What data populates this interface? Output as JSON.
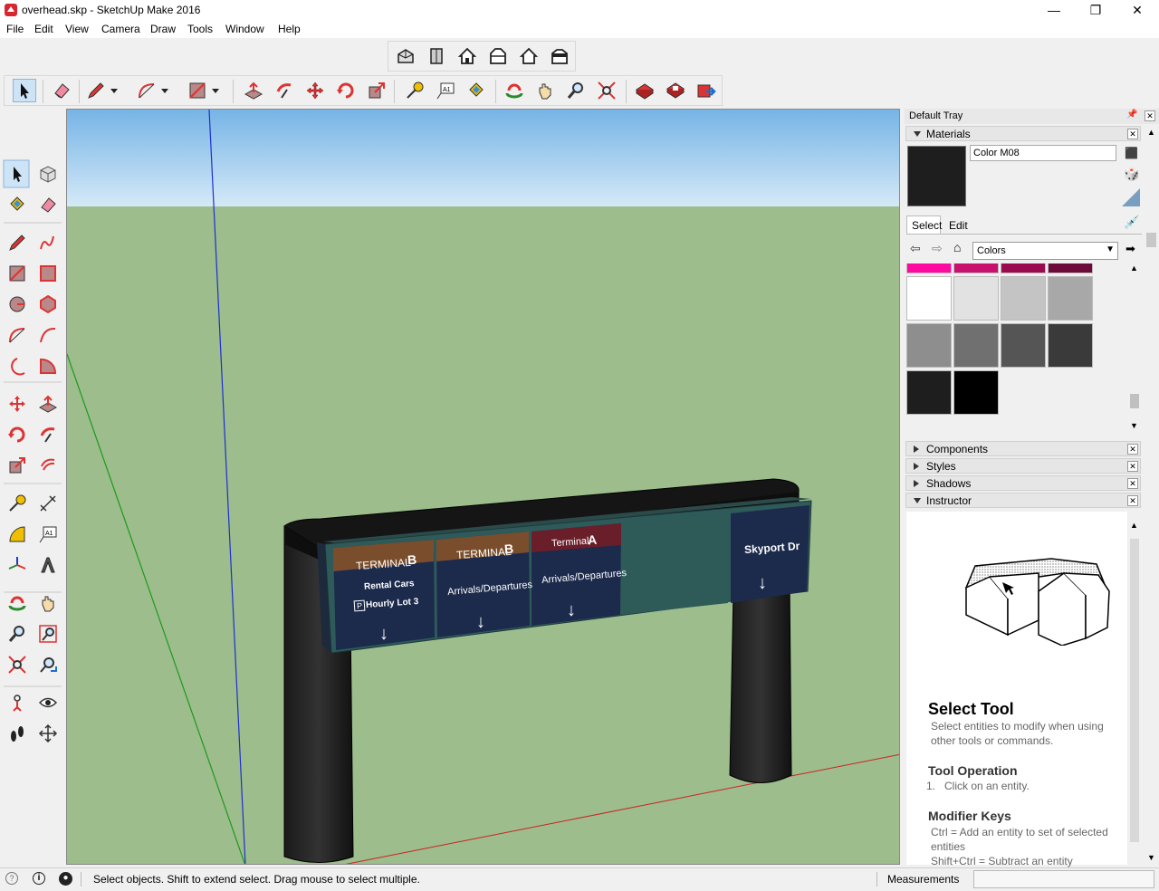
{
  "window": {
    "title": "overhead.skp - SketchUp Make 2016",
    "controls": {
      "minimize": "—",
      "maximize": "❐",
      "close": "✕"
    }
  },
  "menu": [
    "File",
    "Edit",
    "View",
    "Camera",
    "Draw",
    "Tools",
    "Window",
    "Help"
  ],
  "toolbars": {
    "views": [
      "iso-view-icon",
      "top-view-icon",
      "front-view-icon",
      "right-view-icon",
      "back-view-icon",
      "left-view-icon"
    ],
    "main": [
      "select-icon",
      "eraser-icon",
      "pencil-icon",
      "arc-icon",
      "rectangle-icon",
      "push-pull-icon",
      "follow-me-icon",
      "move-icon",
      "rotate-icon",
      "scale-icon",
      "tape-measure-icon",
      "text-icon",
      "paint-bucket-icon",
      "orbit-icon",
      "pan-icon",
      "zoom-icon",
      "zoom-extents-icon",
      "warehouse-icon",
      "extension-warehouse-icon",
      "share-model-icon"
    ]
  },
  "sign": {
    "panels": [
      {
        "title": "TERMINAL",
        "letter": "B",
        "line1": "Rental Cars",
        "line2": "Hourly Lot 3",
        "parking": "P",
        "header_color": "#7a4e2c"
      },
      {
        "title": "TERMINAL",
        "letter": "B",
        "line1": "Arrivals/Departures",
        "header_color": "#7a4e2c"
      },
      {
        "title": "Terminal",
        "letter": "A",
        "line1": "Arrivals/Departures",
        "header_color": "#6a1e2a"
      },
      {
        "title": "Skyport Dr"
      }
    ],
    "arrow": "↓"
  },
  "tray": {
    "title": "Default Tray",
    "materials": {
      "label": "Materials",
      "name": "Color M08",
      "tab_select": "Select",
      "tab_edit": "Edit",
      "library": "Colors",
      "preview_color": "#1e1e1e",
      "swatch_rows": [
        [
          "#ff0aa0",
          "#c8106e",
          "#9a0a4e",
          "#6e0a3a"
        ],
        [
          "#ffffff",
          "#e2e2e2",
          "#c4c4c4",
          "#a8a8a8"
        ],
        [
          "#8e8e8e",
          "#707070",
          "#555555",
          "#3a3a3a"
        ],
        [
          "#1e1e1e",
          "#000000"
        ]
      ]
    },
    "collapsed": [
      "Components",
      "Styles",
      "Shadows"
    ],
    "instructor": {
      "label": "Instructor",
      "tool_title": "Select Tool",
      "tool_desc": "Select entities to modify when using other tools or commands.",
      "op_title": "Tool Operation",
      "op_step": "1.   Click on an entity.",
      "mod_title": "Modifier Keys",
      "mod_1": "Ctrl = Add an entity to set of selected entities",
      "mod_2": "Shift+Ctrl = Subtract an entity"
    }
  },
  "status": {
    "message": "Select objects. Shift to extend select. Drag mouse to select multiple.",
    "measurements_label": "Measurements",
    "measurements_value": ""
  }
}
